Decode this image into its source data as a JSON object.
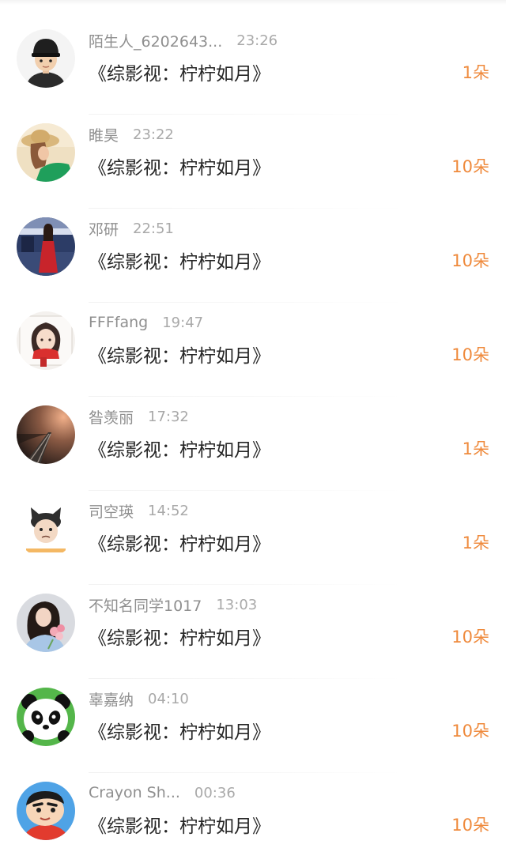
{
  "list": {
    "items": [
      {
        "user": "陌生人_6202643...",
        "time": "23:26",
        "title": "《综影视：柠柠如月》",
        "gift": "1朵",
        "avatar_icon": "boy-black-cap-avatar-icon"
      },
      {
        "user": "睢昊",
        "time": "23:22",
        "title": "《综影视：柠柠如月》",
        "gift": "10朵",
        "avatar_icon": "girl-straw-hat-avatar-icon"
      },
      {
        "user": "邓研",
        "time": "22:51",
        "title": "《综影视：柠柠如月》",
        "gift": "10朵",
        "avatar_icon": "woman-red-dress-avatar-icon"
      },
      {
        "user": "FFFfang",
        "time": "19:47",
        "title": "《综影视：柠柠如月》",
        "gift": "10朵",
        "avatar_icon": "cartoon-girl-red-scarf-avatar-icon"
      },
      {
        "user": "昝羡丽",
        "time": "17:32",
        "title": "《综影视：柠柠如月》",
        "gift": "1朵",
        "avatar_icon": "railway-sunset-avatar-icon"
      },
      {
        "user": "司空瑛",
        "time": "14:52",
        "title": "《综影视：柠柠如月》",
        "gift": "1朵",
        "avatar_icon": "cartoon-cat-hat-avatar-icon"
      },
      {
        "user": "不知名同学1017",
        "time": "13:03",
        "title": "《综影视：柠柠如月》",
        "gift": "10朵",
        "avatar_icon": "girl-flowers-avatar-icon"
      },
      {
        "user": "辜嘉纳",
        "time": "04:10",
        "title": "《综影视：柠柠如月》",
        "gift": "10朵",
        "avatar_icon": "panda-avatar-icon"
      },
      {
        "user": "Crayon Sh...",
        "time": "00:36",
        "title": "《综影视：柠柠如月》",
        "gift": "10朵",
        "avatar_icon": "crayon-shinchan-avatar-icon"
      }
    ]
  },
  "colors": {
    "gift_accent": "#ef8a3c",
    "user_name": "#8f8f8f",
    "time": "#a9a9a9",
    "title": "#262626"
  }
}
